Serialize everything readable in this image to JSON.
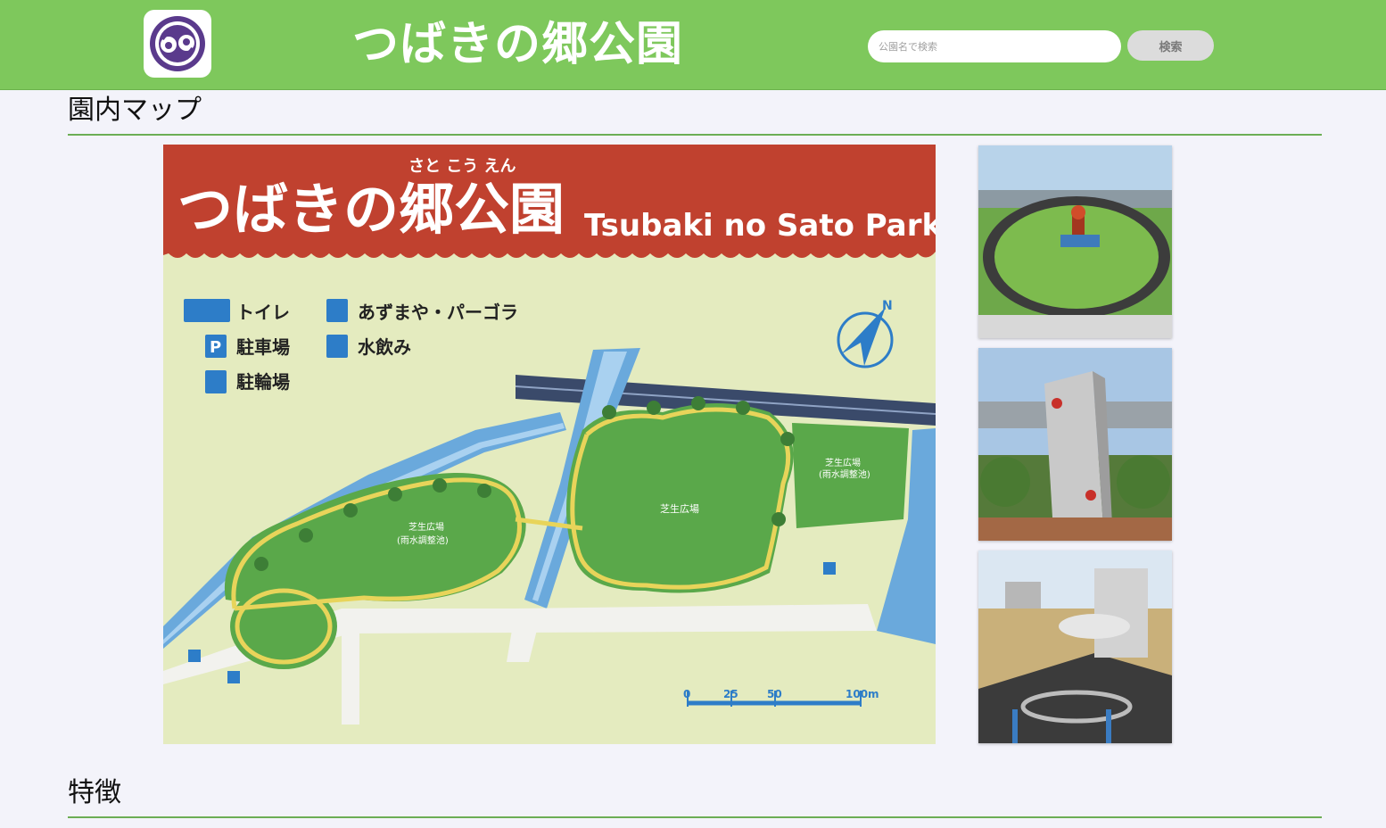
{
  "header": {
    "title": "つばきの郷公園",
    "search_placeholder": "公園名で検索",
    "search_button": "検索"
  },
  "sections": {
    "map_heading": "園内マップ",
    "features_heading": "特徴"
  },
  "map": {
    "ruby": "さと こう えん",
    "title_ja": "つばきの郷公園",
    "title_en": "Tsubaki no Sato Park",
    "legend": {
      "toilet": "トイレ",
      "parking": "駐車場",
      "bicycle": "駐輪場",
      "arbor": "あずまや・パーゴラ",
      "fountain": "水飲み"
    },
    "areas": {
      "lawn_center": "芝生広場",
      "lawn_left": "芝生広場",
      "lawn_left_sub": "(雨水調整池)",
      "lawn_right": "芝生広場",
      "lawn_right_sub": "(雨水調整池)"
    },
    "scale": [
      "0",
      "25",
      "50",
      "100m"
    ],
    "compass": "N"
  },
  "colors": {
    "header_bg": "#7ec85c",
    "accent_line": "#6cae55",
    "banner_red": "#c0412f",
    "logo_purple": "#5a3a8c"
  }
}
